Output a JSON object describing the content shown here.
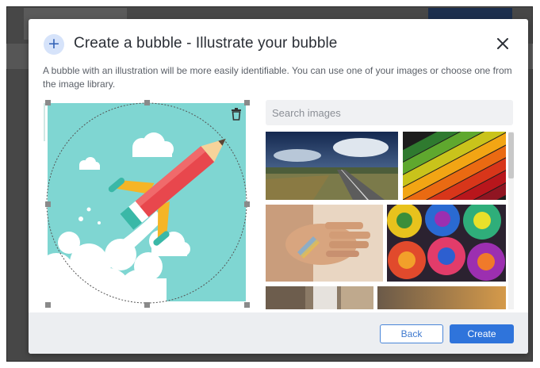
{
  "dialog": {
    "plus_glyph": "+",
    "title": "Create a bubble - Illustrate your bubble",
    "description": "A bubble with an illustration will be more easily identifiable. You can use one of your images or choose one from the image library."
  },
  "editor": {
    "selected_image_icon": "rocket-pencil-illustration",
    "trash_icon": "trash-icon"
  },
  "search": {
    "placeholder": "Search images",
    "value": ""
  },
  "gallery": {
    "thumbnails": [
      {
        "subject": "road-landscape"
      },
      {
        "subject": "colored-pencils"
      },
      {
        "subject": "hand-light"
      },
      {
        "subject": "rainbow-roses"
      },
      {
        "subject": "waterfall"
      },
      {
        "subject": "sunset-sky"
      }
    ]
  },
  "footer": {
    "back_label": "Back",
    "create_label": "Create"
  },
  "colors": {
    "accent": "#2f74db",
    "illustration_bg": "#7fd6d2",
    "footer_bg": "#eceef1"
  }
}
